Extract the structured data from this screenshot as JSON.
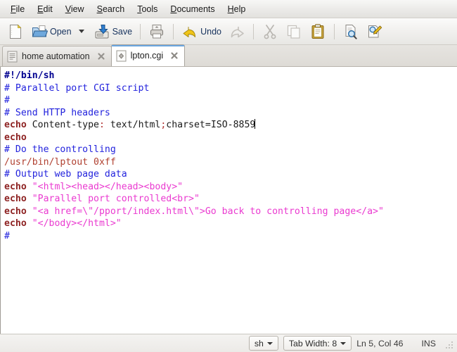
{
  "window": {
    "title": "lpton.cgi"
  },
  "menubar": {
    "items": [
      {
        "label": "File",
        "mnemonic": "F"
      },
      {
        "label": "Edit",
        "mnemonic": "E"
      },
      {
        "label": "View",
        "mnemonic": "V"
      },
      {
        "label": "Search",
        "mnemonic": "S"
      },
      {
        "label": "Tools",
        "mnemonic": "T"
      },
      {
        "label": "Documents",
        "mnemonic": "D"
      },
      {
        "label": "Help",
        "mnemonic": "H"
      }
    ]
  },
  "toolbar": {
    "new_label": "",
    "open_label": "Open",
    "save_label": "Save",
    "print_label": "",
    "undo_label": "Undo",
    "redo_label": "",
    "cut_label": "",
    "copy_label": "",
    "paste_label": "",
    "find_label": "",
    "replace_label": ""
  },
  "tabs": [
    {
      "label": "home automation",
      "icon": "text-file-icon",
      "active": false
    },
    {
      "label": "lpton.cgi",
      "icon": "script-file-icon",
      "active": true
    }
  ],
  "editor": {
    "lines": [
      [
        {
          "t": "#!/bin/sh",
          "c": "shebang"
        }
      ],
      [
        {
          "t": "# Parallel port CGI script",
          "c": "comment"
        }
      ],
      [
        {
          "t": "#",
          "c": "comment"
        }
      ],
      [
        {
          "t": "# Send HTTP headers",
          "c": "comment"
        }
      ],
      [
        {
          "t": "echo",
          "c": "kw"
        },
        {
          "t": " Content-type",
          "c": "plain"
        },
        {
          "t": ":",
          "c": "op"
        },
        {
          "t": " text/html",
          "c": "plain"
        },
        {
          "t": ";",
          "c": "op"
        },
        {
          "t": "charset=ISO-8859",
          "c": "plain"
        },
        {
          "t": "",
          "c": "cursor"
        }
      ],
      [
        {
          "t": "echo",
          "c": "kw"
        }
      ],
      [
        {
          "t": "# Do the controlling",
          "c": "comment"
        }
      ],
      [
        {
          "t": "/usr/bin/lptout 0xff",
          "c": "cmd"
        }
      ],
      [
        {
          "t": "# Output web page data",
          "c": "comment"
        }
      ],
      [
        {
          "t": "echo",
          "c": "kw"
        },
        {
          "t": " ",
          "c": "plain"
        },
        {
          "t": "\"<html><head></head><body>\"",
          "c": "str"
        }
      ],
      [
        {
          "t": "echo",
          "c": "kw"
        },
        {
          "t": " ",
          "c": "plain"
        },
        {
          "t": "\"Parallel port controlled<br>\"",
          "c": "str"
        }
      ],
      [
        {
          "t": "echo",
          "c": "kw"
        },
        {
          "t": " ",
          "c": "plain"
        },
        {
          "t": "\"<a href=\\\"/pport/index.html\\\">Go back to controlling page</a>\"",
          "c": "str"
        }
      ],
      [
        {
          "t": "echo",
          "c": "kw"
        },
        {
          "t": " ",
          "c": "plain"
        },
        {
          "t": "\"</body></html>\"",
          "c": "str"
        }
      ],
      [
        {
          "t": "#",
          "c": "comment"
        }
      ]
    ]
  },
  "statusbar": {
    "language": "sh",
    "tab_width": "Tab Width: 8",
    "position": "Ln 5, Col 46",
    "insert_mode": "INS"
  },
  "colors": {
    "shebang": "#000090",
    "comment": "#2323dd",
    "keyword": "#8e2323",
    "string": "#ea3ad0",
    "command": "#b04030",
    "tab_accent": "#6aa6e0"
  }
}
